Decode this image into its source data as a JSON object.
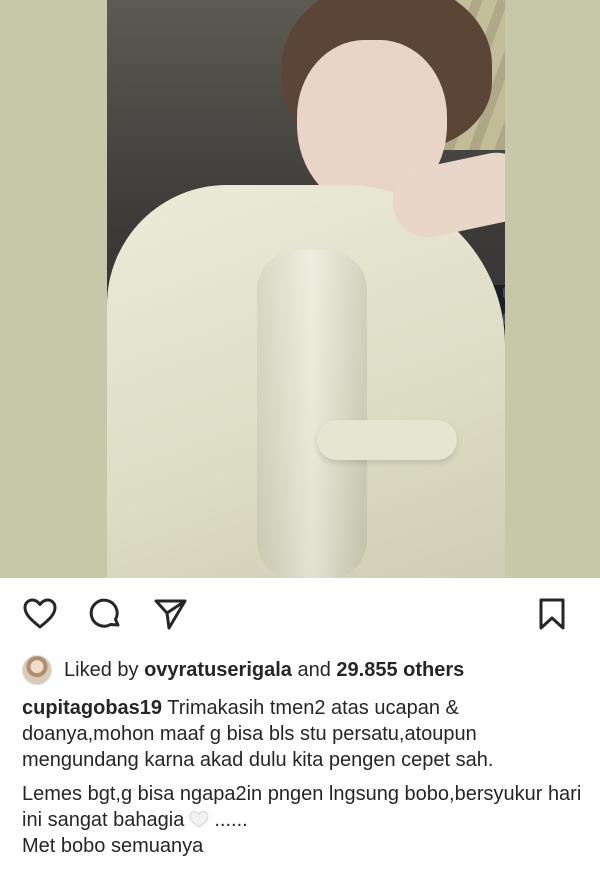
{
  "post": {
    "photo_alt": ""
  },
  "actions": {
    "like_icon": "heart-outline-icon",
    "comment_icon": "comment-bubble-icon",
    "share_icon": "paper-plane-icon",
    "save_icon": "bookmark-icon"
  },
  "likes": {
    "prefix": "Liked by ",
    "user": "ovyratuserigala",
    "middle": " and ",
    "count": "29.855 others"
  },
  "caption": {
    "username": "cupitagobas19",
    "line1": " Trimakasih tmen2 atas ucapan & doanya,mohon maaf g bisa bls stu persatu,atoupun mengundang karna akad dulu kita pengen cepet sah.",
    "line2_a": "Lemes bgt,g bisa ngapa2in pngen lngsung bobo,bersyukur hari ini sangat bahagia",
    "line2_b": "......",
    "line3": "Met bobo semuanya"
  },
  "colors": {
    "background": "#ffffff",
    "text": "#262626",
    "photo_bg": "#c6c8a9"
  }
}
